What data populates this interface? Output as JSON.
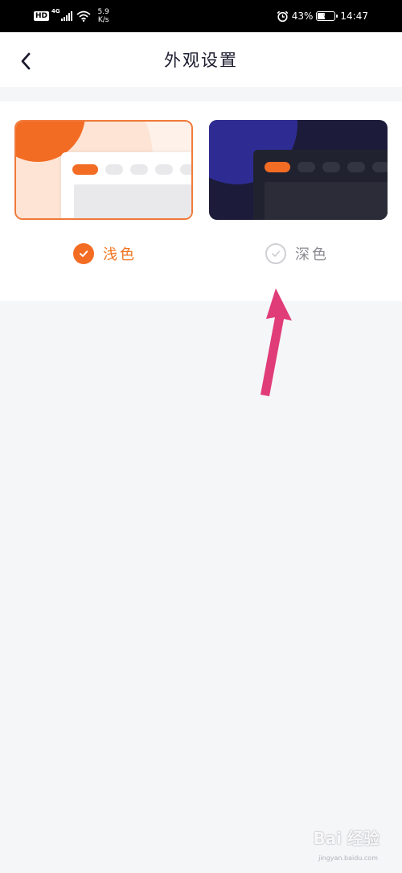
{
  "status_bar": {
    "hd": "HD",
    "network": "4G",
    "speed_value": "5.9",
    "speed_unit": "K/s",
    "battery_percent": "43%",
    "time": "14:47",
    "icons": [
      "hd-icon",
      "signal-icon",
      "wifi-icon",
      "alarm-icon",
      "battery-icon"
    ]
  },
  "nav": {
    "title": "外观设置",
    "back_icon": "chevron-left-icon"
  },
  "themes": [
    {
      "id": "light",
      "label": "浅色",
      "selected": true
    },
    {
      "id": "dark",
      "label": "深色",
      "selected": false
    }
  ],
  "colors": {
    "accent": "#f36c23",
    "dark_card": "#1c1b3a",
    "page_bg": "#f5f6f8",
    "annotation_arrow": "#e03c78"
  },
  "watermark": {
    "text": "Bai 经验",
    "sub": "jingyan.baidu.com"
  }
}
